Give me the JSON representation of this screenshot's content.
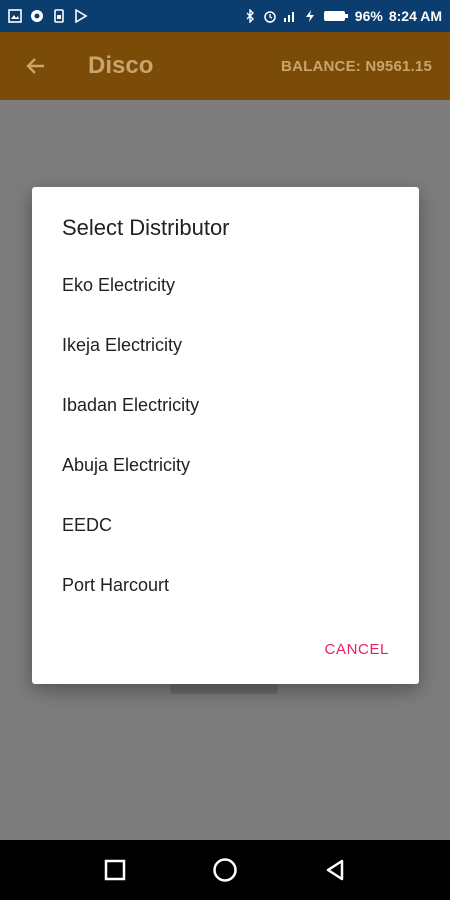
{
  "status_bar": {
    "battery": "96%",
    "time": "8:24 AM",
    "icons": [
      "image-icon",
      "circle-icon",
      "sim-icon",
      "play-icon",
      "bluetooth-icon",
      "alarm-icon",
      "signal-icon",
      "charging-icon",
      "battery-icon"
    ]
  },
  "app_bar": {
    "title": "Disco",
    "balance": "BALANCE: N9561.15",
    "back_icon": "arrow-left-icon"
  },
  "dialog": {
    "title": "Select Distributor",
    "options": [
      "Eko Electricity",
      "Ikeja Electricity",
      "Ibadan Electricity",
      "Abuja Electricity",
      "EEDC",
      "Port Harcourt"
    ],
    "cancel_label": "CANCEL"
  },
  "nav_bar": {
    "icons": [
      "recents-square-icon",
      "home-circle-icon",
      "back-triangle-icon"
    ]
  },
  "colors": {
    "status_bar": "#0b3d6e",
    "app_bar_dimmed": "#7a4c07",
    "scrim": "#7d7d7d",
    "accent": "#e91e63"
  }
}
